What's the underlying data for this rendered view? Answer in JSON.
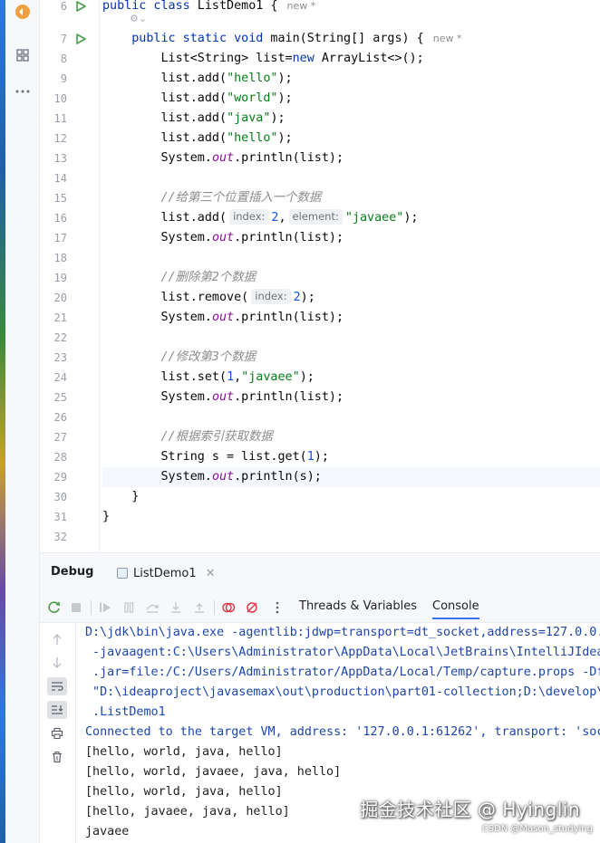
{
  "editor": {
    "line_numbers": [
      "6",
      "7",
      "8",
      "9",
      "10",
      "11",
      "12",
      "13",
      "14",
      "15",
      "16",
      "17",
      "18",
      "19",
      "20",
      "21",
      "22",
      "23",
      "24",
      "25",
      "26",
      "27",
      "28",
      "29",
      "30",
      "31",
      "32"
    ],
    "new_tag": "new *",
    "sub_hint": "⚙︎⌄",
    "lines": {
      "l6": {
        "a": "public class",
        "b": " ListDemo1 {"
      },
      "l7": {
        "a": "    public static void",
        "b": " main(String[] args) {"
      },
      "l8": {
        "a": "        List<String> list=",
        "b": "new",
        "c": " ArrayList<>();"
      },
      "l9": {
        "a": "        list.add(",
        "b": "\"hello\"",
        "c": ");"
      },
      "l10": {
        "a": "        list.add(",
        "b": "\"world\"",
        "c": ");"
      },
      "l11": {
        "a": "        list.add(",
        "b": "\"java\"",
        "c": ");"
      },
      "l12": {
        "a": "        list.add(",
        "b": "\"hello\"",
        "c": ");"
      },
      "l13": {
        "a": "        System.",
        "b": "out",
        "c": ".println(list);"
      },
      "l15": {
        "a": "        ",
        "b": "//给第三个位置插入一个数据"
      },
      "l16": {
        "a": "        list.add(",
        "hint1": "index:",
        "b": "2",
        "c": ",",
        "hint2": "element:",
        "d": "\"javaee\"",
        "e": ");"
      },
      "l17": {
        "a": "        System.",
        "b": "out",
        "c": ".println(list);"
      },
      "l19": {
        "a": "        ",
        "b": "//删除第2个数据"
      },
      "l20": {
        "a": "        list.remove(",
        "hint1": "index:",
        "b": "2",
        "c": ");"
      },
      "l21": {
        "a": "        System.",
        "b": "out",
        "c": ".println(list);"
      },
      "l23": {
        "a": "        ",
        "b": "//修改第3个数据"
      },
      "l24": {
        "a": "        list.set(",
        "b": "1",
        "c": ",",
        "d": "\"javaee\"",
        "e": ");"
      },
      "l25": {
        "a": "        System.",
        "b": "out",
        "c": ".println(list);"
      },
      "l27": {
        "a": "        ",
        "b": "//根据索引获取数据"
      },
      "l28": {
        "a": "        String s = list.get(",
        "b": "1",
        "c": ");"
      },
      "l29": {
        "a": "        System.",
        "b": "out",
        "c": ".println(s);"
      },
      "l30": {
        "a": "    }"
      },
      "l31": {
        "a": "}"
      }
    }
  },
  "debug": {
    "title": "Debug",
    "tab_label": "ListDemo1",
    "tabs": {
      "threads": "Threads & Variables",
      "console": "Console"
    }
  },
  "console": {
    "lines": [
      "D:\\jdk\\bin\\java.exe -agentlib:jdwp=transport=dt_socket,address=127.0.0.",
      " -javaagent:C:\\Users\\Administrator\\AppData\\Local\\JetBrains\\IntelliJIdea",
      " .jar=file:/C:/Users/Administrator/AppData/Local/Temp/capture.props -Df",
      " \"D:\\ideaproject\\javasemax\\out\\production\\part01-collection;D:\\develop\\",
      " .ListDemo1",
      "Connected to the target VM, address: '127.0.0.1:61262', transport: 'soc",
      "[hello, world, java, hello]",
      "[hello, world, javaee, java, hello]",
      "[hello, world, java, hello]",
      "[hello, javaee, java, hello]",
      "javaee"
    ]
  },
  "watermark": {
    "main": "掘金技术社区 @ Hyinglin",
    "sub": "CSDN @Mason_studying"
  },
  "colors": {
    "keyword": "#0033b3",
    "string": "#067d17",
    "number": "#1750eb",
    "field": "#871094",
    "comment": "#8c8c8c",
    "console_sys": "#1d46a8",
    "accent": "#3574f0"
  }
}
